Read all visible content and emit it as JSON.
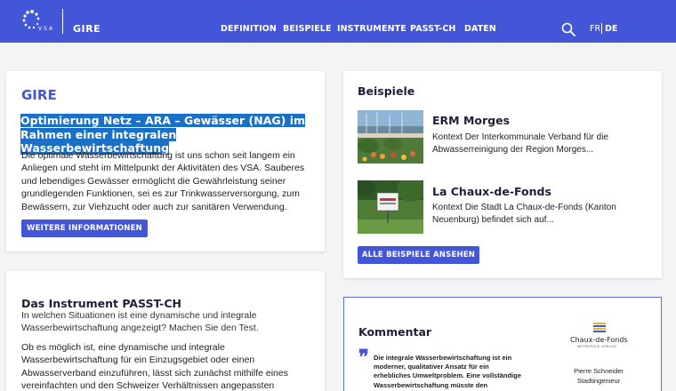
{
  "header": {
    "logo_text": "VSA",
    "brand": "GIRE",
    "nav": [
      "DEFINITION",
      "BEISPIELE",
      "INSTRUMENTE",
      "PASST-CH",
      "DATEN"
    ],
    "search_icon": "search-icon",
    "lang_fr": "FR",
    "lang_de": "DE",
    "colors": {
      "header_bg": "#4456d8",
      "accent": "#4456d8",
      "highlight": "#1a6fc7"
    }
  },
  "gire": {
    "title": "GIRE",
    "headline": "Optimierung Netz – ARA – Gewässer (NAG) im Rahmen einer integralen Wasserbewirtschaftung",
    "body": "Die optimale Wasserbewirtschaftung ist uns schon seit langem ein Anliegen und steht im Mittelpunkt der Aktivitäten des VSA. Sauberes und lebendiges Gewässer ermöglicht die Gewährleistung seiner grundlegenden Funktionen, sei es zur Trinkwasserversorgung, zum Bewässern, zur Viehzucht oder auch zur sanitären Verwendung.",
    "button": "WEITERE INFORMATIONEN"
  },
  "passt": {
    "title": "Das Instrument PASST-CH",
    "subtitle": "In welchen Situationen ist eine dynamische und integrale Wasserbewirtschaftung angezeigt? Machen Sie den Test.",
    "body": "Ob es möglich ist, eine dynamische und integrale Wasserbewirtschaftung für ein Einzugsgebiet oder einen Abwasserverband einzuführen, lässt sich zunächst mithilfe eines vereinfachten und den Schweizer Verhältnissen angepassten"
  },
  "beispiele": {
    "title": "Beispiele",
    "items": [
      {
        "title": "ERM Morges",
        "text": "Kontext Der Interkommunale Verband für die Abwasserreinigung der Region Morges..."
      },
      {
        "title": "La Chaux-de-Fonds",
        "text": "Kontext Die Stadt La Chaux-de-Fonds (Kanton Neuenburg) befindet sich auf..."
      }
    ],
    "button": "ALLE BEISPIELE ANSEHEN"
  },
  "kommentar": {
    "title": "Kommentar",
    "quote": "Die integrale Wasserbewirtschaftung ist ein moderner, qualitativer Ansatz für ein erhebliches Umweltproblem. Eine vollständige Wasserbewirtschaftung müsste den kompletten",
    "quote_icon": "quote-icon",
    "city_name": "Chaux-de-Fonds",
    "city_sub": "MÉTROPOLE HORLOG",
    "person_name": "Pierre Schneider",
    "person_role": "Stadtingenieur"
  }
}
